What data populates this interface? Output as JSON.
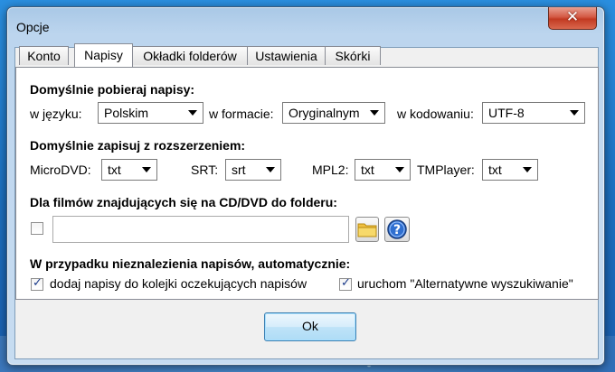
{
  "window": {
    "title": "Opcje",
    "close_label": "✕"
  },
  "tabs": [
    {
      "label": "Konto"
    },
    {
      "label": "Napisy"
    },
    {
      "label": "Okładki folderów"
    },
    {
      "label": "Ustawienia"
    },
    {
      "label": "Skórki"
    }
  ],
  "download": {
    "heading": "Domyślnie pobieraj napisy:",
    "language_label": "w języku:",
    "language_value": "Polskim",
    "format_label": "w formacie:",
    "format_value": "Oryginalnym",
    "encoding_label": "w kodowaniu:",
    "encoding_value": "UTF-8"
  },
  "save": {
    "heading": "Domyślnie zapisuj z rozszerzeniem:",
    "microdvd_label": "MicroDVD:",
    "microdvd_value": "txt",
    "srt_label": "SRT:",
    "srt_value": "srt",
    "mpl2_label": "MPL2:",
    "mpl2_value": "txt",
    "tmplayer_label": "TMPlayer:",
    "tmplayer_value": "txt"
  },
  "cd": {
    "heading": "Dla filmów znajdujących się na CD/DVD do folderu:",
    "enabled": false,
    "path_value": ""
  },
  "notfound": {
    "heading": "W przypadku nieznalezienia napisów, automatycznie:",
    "queue_label": "dodaj napisy do kolejki oczekujących napisów",
    "queue_checked": true,
    "alt_label": "uruchom \"Alternatywne wyszukiwanie\"",
    "alt_checked": true
  },
  "ok_label": "Ok",
  "check_glyph": "✓"
}
